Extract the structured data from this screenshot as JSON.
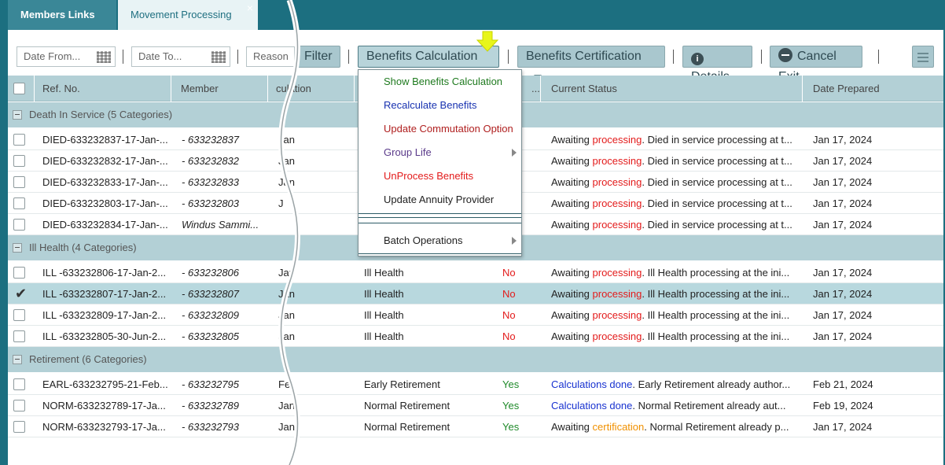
{
  "tabs": {
    "members_links": "Members Links",
    "movement_processing": "Movement Processing",
    "close_glyph": "×"
  },
  "toolbar": {
    "date_from_placeholder": "Date From...",
    "date_to_placeholder": "Date To...",
    "reason_placeholder": "Reason",
    "filter_label": "Filter",
    "benefits_calculation_label": "Benefits Calculation",
    "benefits_certification_label": "Benefits Certification",
    "details_label": "Details",
    "cancel_exit_label": "Cancel Exit",
    "info_glyph": "i"
  },
  "grid": {
    "headers": [
      "Ref. No.",
      "Member",
      "culation",
      "...",
      "Current Status",
      "Date Prepared"
    ],
    "groups": [
      {
        "label": "Death In Service (5 Categories)",
        "rows": [
          {
            "ref": "DIED-633232837-17-Jan-...",
            "member": "- 633232837",
            "calc": "Jan",
            "reason": "",
            "flag": "",
            "status_pre": "Awaiting ",
            "status_hl": "processing",
            "status_post": ". Died in service processing at t...",
            "date": "Jan 17, 2024",
            "selected": false
          },
          {
            "ref": "DIED-633232832-17-Jan-...",
            "member": "- 633232832",
            "calc": "Jan",
            "reason": "",
            "flag": "",
            "status_pre": "Awaiting ",
            "status_hl": "processing",
            "status_post": ". Died in service processing at t...",
            "date": "Jan 17, 2024",
            "selected": false
          },
          {
            "ref": "DIED-633232833-17-Jan-...",
            "member": "- 633232833",
            "calc": "Jan",
            "reason": "",
            "flag": "",
            "status_pre": "Awaiting ",
            "status_hl": "processing",
            "status_post": ". Died in service processing at t...",
            "date": "Jan 17, 2024",
            "selected": false
          },
          {
            "ref": "DIED-633232803-17-Jan-...",
            "member": "- 633232803",
            "calc": "J",
            "reason": "",
            "flag": "",
            "status_pre": "Awaiting ",
            "status_hl": "processing",
            "status_post": ". Died in service processing at t...",
            "date": "Jan 17, 2024",
            "selected": false
          },
          {
            "ref": "DIED-633232834-17-Jan-...",
            "member": "Windus Sammi...",
            "calc": "",
            "reason": "",
            "flag": "",
            "status_pre": "Awaiting ",
            "status_hl": "processing",
            "status_post": ". Died in service processing at t...",
            "date": "Jan 17, 2024",
            "selected": false
          }
        ]
      },
      {
        "label": "Ill Health (4 Categories)",
        "rows": [
          {
            "ref": "ILL -633232806-17-Jan-2...",
            "member": "- 633232806",
            "calc": "Jan",
            "reason": "Ill Health",
            "flag": "No",
            "status_pre": "Awaiting ",
            "status_hl": "processing",
            "status_post": ". Ill Health processing at the ini...",
            "date": "Jan 17, 2024",
            "selected": false
          },
          {
            "ref": "ILL -633232807-17-Jan-2...",
            "member": "- 633232807",
            "calc": "Jan",
            "reason": "Ill Health",
            "flag": "No",
            "status_pre": "Awaiting ",
            "status_hl": "processing",
            "status_post": ". Ill Health processing at the ini...",
            "date": "Jan 17, 2024",
            "selected": true
          },
          {
            "ref": "ILL -633232809-17-Jan-2...",
            "member": "- 633232809",
            "calc": "Jan",
            "reason": "Ill Health",
            "flag": "No",
            "status_pre": "Awaiting ",
            "status_hl": "processing",
            "status_post": ". Ill Health processing at the ini...",
            "date": "Jan 17, 2024",
            "selected": false
          },
          {
            "ref": "ILL -633232805-30-Jun-2...",
            "member": "- 633232805",
            "calc": "Jan",
            "reason": "Ill Health",
            "flag": "No",
            "status_pre": "Awaiting ",
            "status_hl": "processing",
            "status_post": ". Ill Health processing at the ini...",
            "date": "Jan 17, 2024",
            "selected": false
          }
        ]
      },
      {
        "label": "Retirement (6 Categories)",
        "rows": [
          {
            "ref": "EARL-633232795-21-Feb...",
            "member": "- 633232795",
            "calc": "Fe",
            "reason": "Early Retirement",
            "flag": "Yes",
            "status_pre": "",
            "status_hl": "Calculations done",
            "status_post": ". Early Retirement already author...",
            "date": "Feb 21, 2024",
            "selected": false
          },
          {
            "ref": "NORM-633232789-17-Ja...",
            "member": "- 633232789",
            "calc": "Jan",
            "reason": "Normal Retirement",
            "flag": "Yes",
            "status_pre": "",
            "status_hl": "Calculations done",
            "status_post": ". Normal Retirement already aut...",
            "date": "Feb 19, 2024",
            "selected": false
          },
          {
            "ref": "NORM-633232793-17-Ja...",
            "member": "- 633232793",
            "calc": "Jan",
            "reason": "Normal Retirement",
            "flag": "Yes",
            "status_pre": "Awaiting ",
            "status_hl": "certification",
            "status_post": ". Normal Retirement already p...",
            "date": "Jan 17, 2024",
            "selected": false
          }
        ]
      }
    ]
  },
  "dropdown": {
    "items": [
      {
        "label": "Show Benefits Calculation",
        "color": "#1f7a1f"
      },
      {
        "label": "Recalculate Benefits",
        "color": "#1832b0"
      },
      {
        "label": "Update Commutation Option",
        "color": "#b02020"
      },
      {
        "label": "Group Life",
        "color": "#5a3a8a"
      },
      {
        "label": "UnProcess Benefits",
        "color": "#e31b1b"
      },
      {
        "label": "Update Annuity Provider",
        "color": "#222222"
      }
    ],
    "batch_label": "Batch Operations"
  },
  "colors": {
    "teal_dark": "#1c6f80",
    "header_bg": "#b3d0d6",
    "button_bg": "#a9c7ce",
    "highlight_arrow": "#e8f51a"
  }
}
